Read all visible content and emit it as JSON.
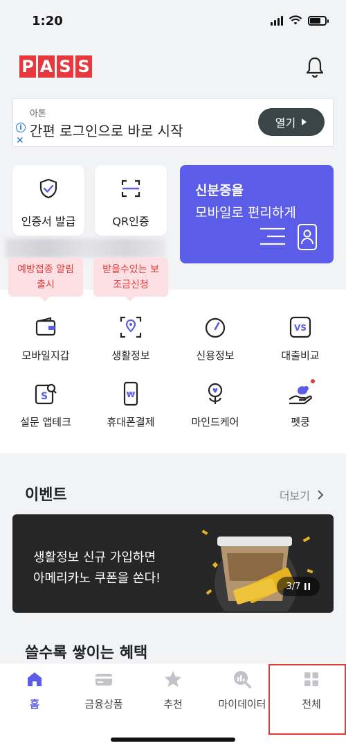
{
  "status": {
    "time": "1:20"
  },
  "header": {
    "logo_letters": [
      "P",
      "A",
      "S",
      "S"
    ]
  },
  "ad": {
    "sponsor": "아톤",
    "title": "간편 로그인으로 바로 시작",
    "button": "열기"
  },
  "quick": {
    "cert": "인증서 발급",
    "qr": "QR인증"
  },
  "id_card": {
    "line1": "신분증을",
    "line2": "모바일로 편리하게"
  },
  "tooltips": {
    "vaccine": "예방접종 알림\n출시",
    "subsidy": "받을수있는 보\n조금신청"
  },
  "services": [
    {
      "label": "모바일지갑"
    },
    {
      "label": "생활정보"
    },
    {
      "label": "신용정보"
    },
    {
      "label": "대출비교"
    },
    {
      "label": "설문 앱테크"
    },
    {
      "label": "휴대폰결제"
    },
    {
      "label": "마인드케어"
    },
    {
      "label": "펫쿵"
    }
  ],
  "events": {
    "title": "이벤트",
    "more": "더보기",
    "banner_line1": "생활정보 신규 가입하면",
    "banner_line2": "아메리카노 쿠폰을 쏜다!",
    "counter": "3/7"
  },
  "benefits": {
    "title": "쓸수록 쌓이는 혜택"
  },
  "tabbar": [
    {
      "label": "홈"
    },
    {
      "label": "금융상품"
    },
    {
      "label": "추천"
    },
    {
      "label": "마이데이터"
    },
    {
      "label": "전체"
    }
  ],
  "colors": {
    "brand": "#5b5ce8",
    "logo_red": "#e6383d",
    "alert_red": "#e53c3c"
  }
}
